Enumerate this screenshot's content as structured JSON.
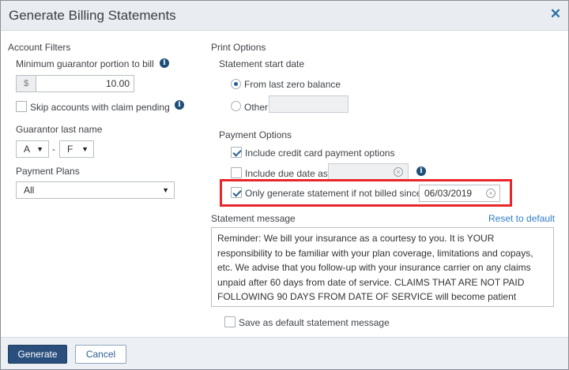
{
  "dialog": {
    "title": "Generate Billing Statements",
    "close_glyph": "✕"
  },
  "account_filters": {
    "heading": "Account Filters",
    "min_portion_label": "Minimum guarantor portion to bill",
    "currency_symbol": "$",
    "min_portion_value": "10.00",
    "skip_claim_label": "Skip accounts with claim pending",
    "skip_claim_checked": false,
    "last_name_label": "Guarantor last name",
    "last_name_from": "A",
    "last_name_separator": "-",
    "last_name_to": "F",
    "payment_plans_label": "Payment Plans",
    "payment_plans_value": "All"
  },
  "print_options": {
    "heading": "Print Options",
    "start_date_label": "Statement start date",
    "radio_zero_balance": "From last zero balance",
    "radio_other": "Other",
    "selected_start": "zero_balance",
    "payment_options_label": "Payment Options",
    "include_cc_label": "Include credit card payment options",
    "include_cc_checked": true,
    "include_due_label": "Include due date as",
    "include_due_checked": false,
    "only_generate_label": "Only generate statement if not billed since",
    "only_generate_checked": true,
    "only_generate_date": "06/03/2019"
  },
  "statement_message": {
    "label": "Statement message",
    "reset_link": "Reset to default",
    "text": "Reminder: We bill your insurance as a courtesy to you. It is YOUR responsibility to be familiar with your plan coverage, limitations and copays, etc. We advise that you follow-up with your insurance carrier on any claims unpaid after 60 days from date of service. CLAIMS THAT ARE NOT PAID FOLLOWING 90 DAYS FROM DATE OF SERVICE will become patient responsibility for payment AT TIME OF VISIT.",
    "save_default_label": "Save as default statement message",
    "save_default_checked": false
  },
  "footer": {
    "generate_label": "Generate",
    "cancel_label": "Cancel"
  },
  "icons": {
    "info": "info-icon",
    "clear": "clear-icon",
    "caret": "chevron-down-icon"
  },
  "colors": {
    "primary_button": "#2b4f7c",
    "highlight_box": "#e8262b",
    "link": "#2f7fc4",
    "checkbox_accent": "#2b5f93"
  }
}
